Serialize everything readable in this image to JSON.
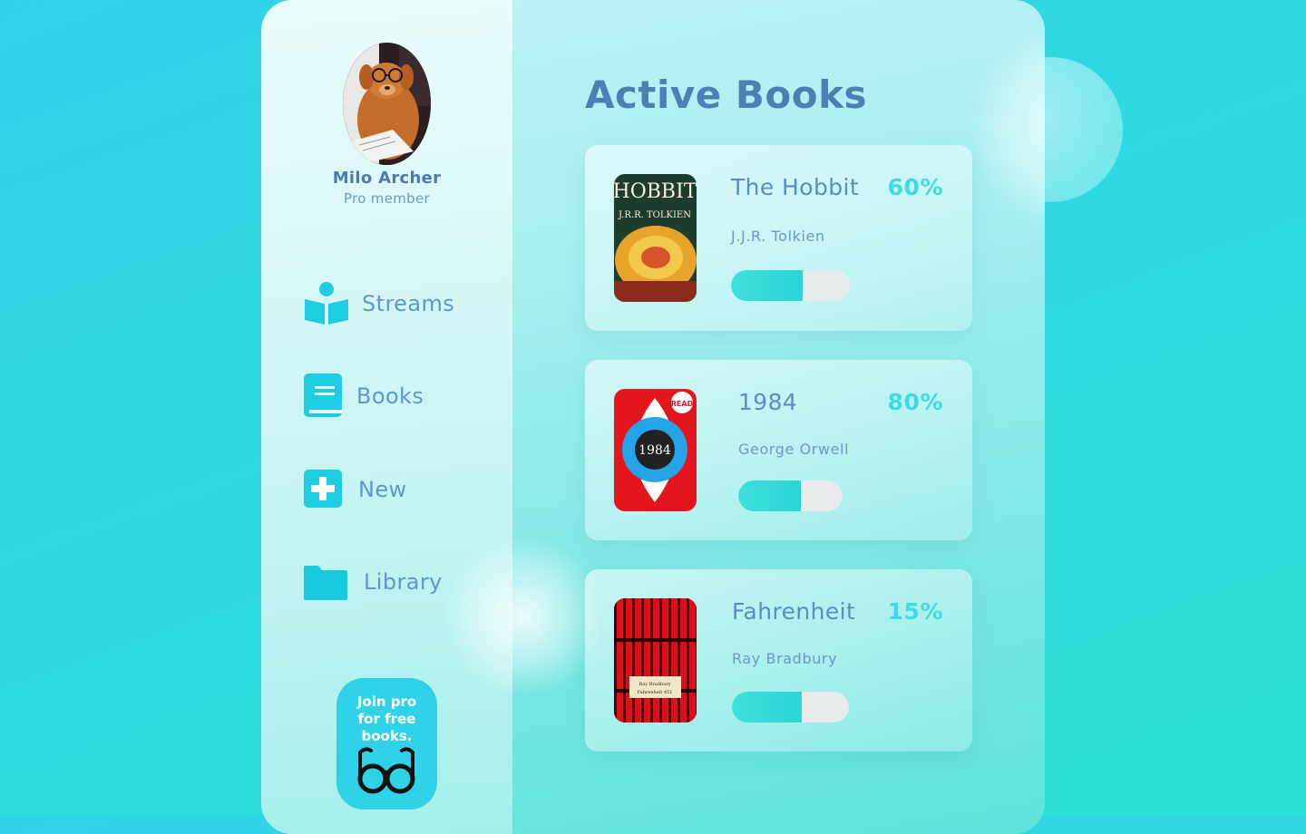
{
  "user": {
    "name": "Milo Archer",
    "role": "Pro member",
    "avatar_icon": "dog-with-glasses-avatar"
  },
  "nav": [
    {
      "label": "Streams",
      "icon": "reader-icon"
    },
    {
      "label": "Books",
      "icon": "book-icon"
    },
    {
      "label": "New",
      "icon": "plus-square-icon"
    },
    {
      "label": "Library",
      "icon": "folder-icon"
    }
  ],
  "promo": {
    "line1": "Join pro",
    "line2": "for free",
    "line3": "books.",
    "icon": "glasses-icon"
  },
  "main": {
    "heading": "Active Books"
  },
  "books": [
    {
      "title": "The Hobbit",
      "author": "J.J.R. Tolkien",
      "progress_label": "60%",
      "progress": 0.6,
      "cover_title": "HOBBIT",
      "cover_author": "J.R.R. TOLKIEN"
    },
    {
      "title": "1984",
      "author": "George Orwell",
      "progress_label": "80%",
      "progress": 0.6,
      "cover_title": "1984",
      "cover_badge": "READ"
    },
    {
      "title": "Fahrenheit",
      "author": "Ray Bradbury",
      "progress_label": "15%",
      "progress": 0.6,
      "cover_author": "Ray Bradbury",
      "cover_title": "Fahrenheit 451"
    }
  ],
  "colors": {
    "accent": "#2fd2e6",
    "text_primary": "#4b7fb6",
    "percent": "#3edbe4",
    "track": "#e6eaeb"
  }
}
